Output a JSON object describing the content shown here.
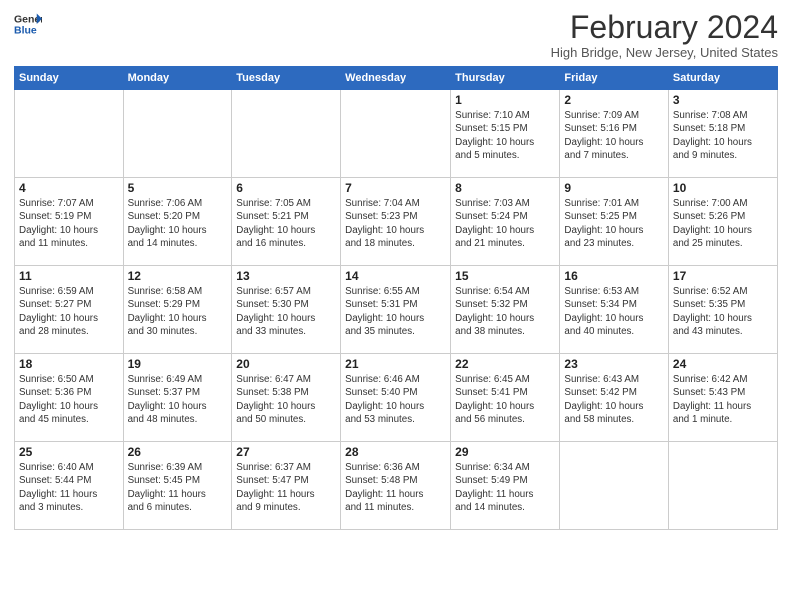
{
  "header": {
    "logo_line1": "General",
    "logo_line2": "Blue",
    "month_title": "February 2024",
    "location": "High Bridge, New Jersey, United States"
  },
  "weekdays": [
    "Sunday",
    "Monday",
    "Tuesday",
    "Wednesday",
    "Thursday",
    "Friday",
    "Saturday"
  ],
  "weeks": [
    [
      {
        "day": "",
        "info": ""
      },
      {
        "day": "",
        "info": ""
      },
      {
        "day": "",
        "info": ""
      },
      {
        "day": "",
        "info": ""
      },
      {
        "day": "1",
        "info": "Sunrise: 7:10 AM\nSunset: 5:15 PM\nDaylight: 10 hours\nand 5 minutes."
      },
      {
        "day": "2",
        "info": "Sunrise: 7:09 AM\nSunset: 5:16 PM\nDaylight: 10 hours\nand 7 minutes."
      },
      {
        "day": "3",
        "info": "Sunrise: 7:08 AM\nSunset: 5:18 PM\nDaylight: 10 hours\nand 9 minutes."
      }
    ],
    [
      {
        "day": "4",
        "info": "Sunrise: 7:07 AM\nSunset: 5:19 PM\nDaylight: 10 hours\nand 11 minutes."
      },
      {
        "day": "5",
        "info": "Sunrise: 7:06 AM\nSunset: 5:20 PM\nDaylight: 10 hours\nand 14 minutes."
      },
      {
        "day": "6",
        "info": "Sunrise: 7:05 AM\nSunset: 5:21 PM\nDaylight: 10 hours\nand 16 minutes."
      },
      {
        "day": "7",
        "info": "Sunrise: 7:04 AM\nSunset: 5:23 PM\nDaylight: 10 hours\nand 18 minutes."
      },
      {
        "day": "8",
        "info": "Sunrise: 7:03 AM\nSunset: 5:24 PM\nDaylight: 10 hours\nand 21 minutes."
      },
      {
        "day": "9",
        "info": "Sunrise: 7:01 AM\nSunset: 5:25 PM\nDaylight: 10 hours\nand 23 minutes."
      },
      {
        "day": "10",
        "info": "Sunrise: 7:00 AM\nSunset: 5:26 PM\nDaylight: 10 hours\nand 25 minutes."
      }
    ],
    [
      {
        "day": "11",
        "info": "Sunrise: 6:59 AM\nSunset: 5:27 PM\nDaylight: 10 hours\nand 28 minutes."
      },
      {
        "day": "12",
        "info": "Sunrise: 6:58 AM\nSunset: 5:29 PM\nDaylight: 10 hours\nand 30 minutes."
      },
      {
        "day": "13",
        "info": "Sunrise: 6:57 AM\nSunset: 5:30 PM\nDaylight: 10 hours\nand 33 minutes."
      },
      {
        "day": "14",
        "info": "Sunrise: 6:55 AM\nSunset: 5:31 PM\nDaylight: 10 hours\nand 35 minutes."
      },
      {
        "day": "15",
        "info": "Sunrise: 6:54 AM\nSunset: 5:32 PM\nDaylight: 10 hours\nand 38 minutes."
      },
      {
        "day": "16",
        "info": "Sunrise: 6:53 AM\nSunset: 5:34 PM\nDaylight: 10 hours\nand 40 minutes."
      },
      {
        "day": "17",
        "info": "Sunrise: 6:52 AM\nSunset: 5:35 PM\nDaylight: 10 hours\nand 43 minutes."
      }
    ],
    [
      {
        "day": "18",
        "info": "Sunrise: 6:50 AM\nSunset: 5:36 PM\nDaylight: 10 hours\nand 45 minutes."
      },
      {
        "day": "19",
        "info": "Sunrise: 6:49 AM\nSunset: 5:37 PM\nDaylight: 10 hours\nand 48 minutes."
      },
      {
        "day": "20",
        "info": "Sunrise: 6:47 AM\nSunset: 5:38 PM\nDaylight: 10 hours\nand 50 minutes."
      },
      {
        "day": "21",
        "info": "Sunrise: 6:46 AM\nSunset: 5:40 PM\nDaylight: 10 hours\nand 53 minutes."
      },
      {
        "day": "22",
        "info": "Sunrise: 6:45 AM\nSunset: 5:41 PM\nDaylight: 10 hours\nand 56 minutes."
      },
      {
        "day": "23",
        "info": "Sunrise: 6:43 AM\nSunset: 5:42 PM\nDaylight: 10 hours\nand 58 minutes."
      },
      {
        "day": "24",
        "info": "Sunrise: 6:42 AM\nSunset: 5:43 PM\nDaylight: 11 hours\nand 1 minute."
      }
    ],
    [
      {
        "day": "25",
        "info": "Sunrise: 6:40 AM\nSunset: 5:44 PM\nDaylight: 11 hours\nand 3 minutes."
      },
      {
        "day": "26",
        "info": "Sunrise: 6:39 AM\nSunset: 5:45 PM\nDaylight: 11 hours\nand 6 minutes."
      },
      {
        "day": "27",
        "info": "Sunrise: 6:37 AM\nSunset: 5:47 PM\nDaylight: 11 hours\nand 9 minutes."
      },
      {
        "day": "28",
        "info": "Sunrise: 6:36 AM\nSunset: 5:48 PM\nDaylight: 11 hours\nand 11 minutes."
      },
      {
        "day": "29",
        "info": "Sunrise: 6:34 AM\nSunset: 5:49 PM\nDaylight: 11 hours\nand 14 minutes."
      },
      {
        "day": "",
        "info": ""
      },
      {
        "day": "",
        "info": ""
      }
    ]
  ]
}
